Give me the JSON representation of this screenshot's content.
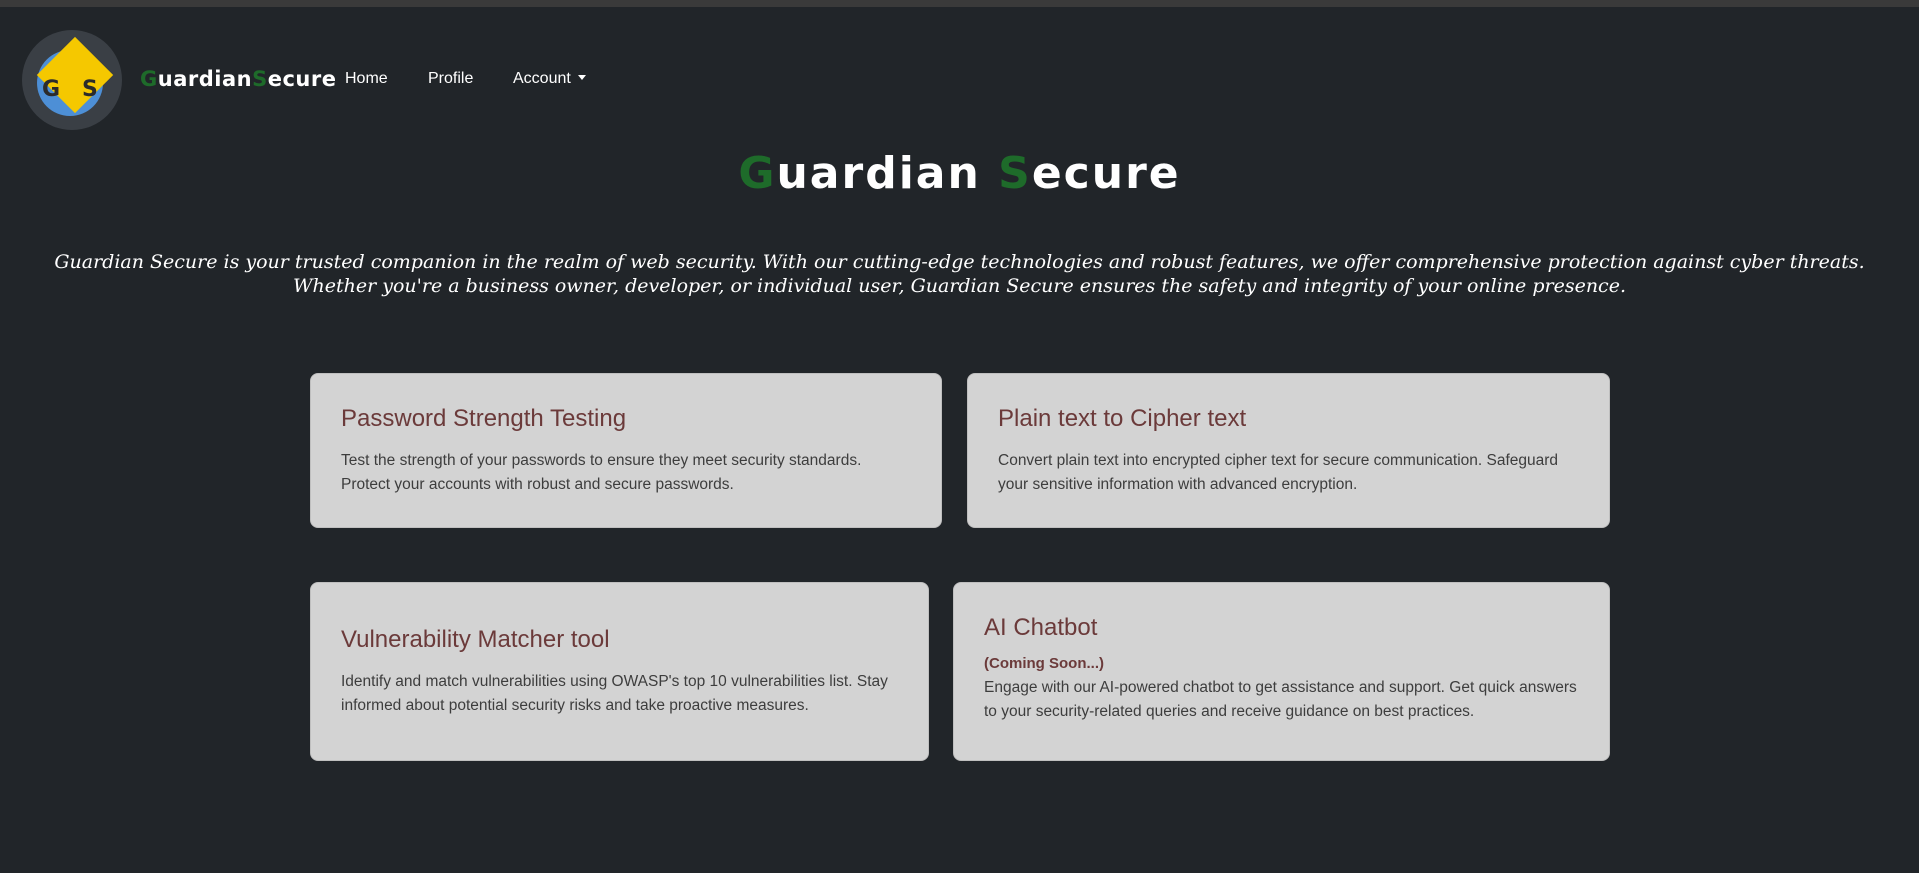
{
  "brand": {
    "logo_letters": [
      "G",
      "S"
    ],
    "name_part1_first": "G",
    "name_part1_rest": "uardian",
    "name_part2_first": "S",
    "name_part2_rest": "ecure"
  },
  "nav": {
    "items": [
      {
        "label": "Home"
      },
      {
        "label": "Profile"
      },
      {
        "label": "Account"
      }
    ]
  },
  "hero": {
    "title_word1_first": "G",
    "title_word1_rest": "uardian",
    "title_word2_first": "S",
    "title_word2_rest": "ecure",
    "intro": "Guardian Secure is your trusted companion in the realm of web security. With our cutting-edge technologies and robust features, we offer comprehensive protection against cyber threats. Whether you're a business owner, developer, or individual user, Guardian Secure ensures the safety and integrity of your online presence."
  },
  "cards": [
    {
      "title": "Password Strength Testing",
      "description": "Test the strength of your passwords to ensure they meet security standards. Protect your accounts with robust and secure passwords."
    },
    {
      "title": "Plain text to Cipher text",
      "description": "Convert plain text into encrypted cipher text for secure communication. Safeguard your sensitive information with advanced encryption."
    },
    {
      "title": "Vulnerability Matcher tool",
      "description": "Identify and match vulnerabilities using OWASP's top 10 vulnerabilities list. Stay informed about potential security risks and take proactive measures."
    },
    {
      "title": "AI Chatbot",
      "badge": "(Coming Soon...)",
      "description": "Engage with our AI-powered chatbot to get assistance and support. Get quick answers to your security-related queries and receive guidance on best practices."
    }
  ],
  "colors": {
    "background": "#212529",
    "accent_green": "#1e6b2a",
    "card_background": "#d3d3d3",
    "card_title": "#6b3a3a",
    "logo_yellow": "#f5c800",
    "logo_blue": "#4d8fd6"
  }
}
